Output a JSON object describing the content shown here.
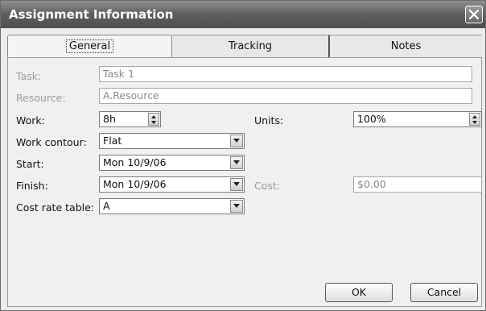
{
  "dialog": {
    "title": "Assignment Information"
  },
  "tabs": [
    {
      "label": "General",
      "active": true
    },
    {
      "label": "Tracking",
      "active": false
    },
    {
      "label": "Notes",
      "active": false
    }
  ],
  "fields": {
    "task": {
      "label": "Task:",
      "value": "Task 1",
      "enabled": false
    },
    "resource": {
      "label": "Resource:",
      "value": "A.Resource",
      "enabled": false
    },
    "work": {
      "label": "Work:",
      "value": "8h"
    },
    "units": {
      "label": "Units:",
      "value": "100%"
    },
    "work_contour": {
      "label": "Work contour:",
      "value": "Flat"
    },
    "start": {
      "label": "Start:",
      "value": "Mon 10/9/06"
    },
    "finish": {
      "label": "Finish:",
      "value": "Mon 10/9/06"
    },
    "cost": {
      "label": "Cost:",
      "value": "$0.00",
      "enabled": false
    },
    "cost_rate_table": {
      "label": "Cost rate table:",
      "value": "A"
    }
  },
  "buttons": {
    "ok": "OK",
    "cancel": "Cancel"
  },
  "icons": {
    "close": "close-icon",
    "dropdown": "chevron-down-icon",
    "spinner": "spinner-icon"
  }
}
